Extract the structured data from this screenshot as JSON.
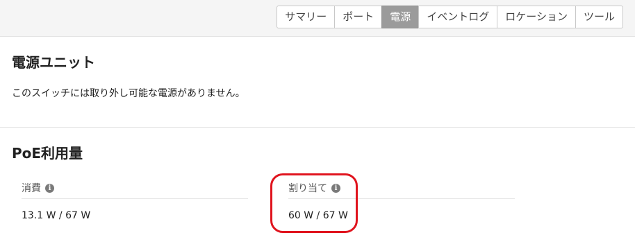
{
  "tabs": [
    {
      "label": "サマリー",
      "active": false
    },
    {
      "label": "ポート",
      "active": false
    },
    {
      "label": "電源",
      "active": true
    },
    {
      "label": "イベントログ",
      "active": false
    },
    {
      "label": "ロケーション",
      "active": false
    },
    {
      "label": "ツール",
      "active": false
    }
  ],
  "power_supply": {
    "title": "電源ユニット",
    "message": "このスイッチには取り外し可能な電源がありません。"
  },
  "poe": {
    "title": "PoE利用量",
    "consumed": {
      "label": "消費",
      "icon": "info-icon",
      "value": "13.1 W / 67 W"
    },
    "allocated": {
      "label": "割り当て",
      "icon": "info-icon",
      "value": "60 W / 67 W"
    }
  },
  "colors": {
    "active_tab": "#9b9b9b",
    "highlight": "#e0141e"
  }
}
